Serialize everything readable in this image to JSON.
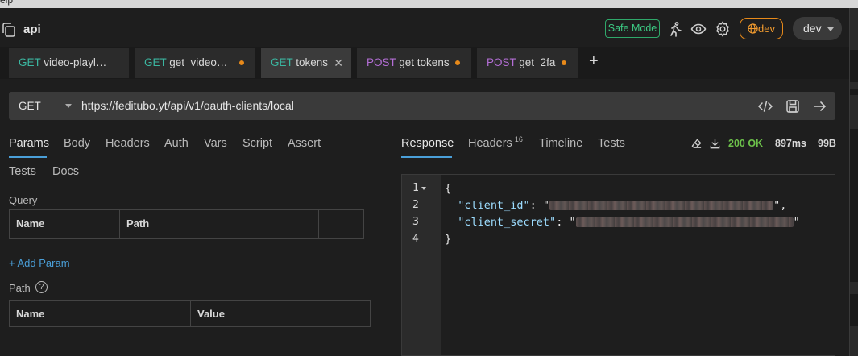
{
  "menubar": {
    "text": "elp"
  },
  "header": {
    "title": "api",
    "safe_mode": "Safe Mode",
    "env_badge": "dev",
    "env_select": "dev",
    "icons": [
      "collection-icon",
      "runner-icon",
      "eye-icon",
      "gear-icon",
      "globe-icon"
    ]
  },
  "tabs": [
    {
      "method": "GET",
      "name": "video-playl…",
      "unsaved": false
    },
    {
      "method": "GET",
      "name": "get_video…",
      "unsaved": true
    },
    {
      "method": "GET",
      "name": "tokens",
      "active": true,
      "closable": true
    },
    {
      "method": "POST",
      "name": "get tokens",
      "unsaved": true
    },
    {
      "method": "POST",
      "name": "get_2fa",
      "unsaved": true
    }
  ],
  "request": {
    "method": "GET",
    "url": "https://feditubo.yt/api/v1/oauth-clients/local"
  },
  "request_tabs": [
    "Params",
    "Body",
    "Headers",
    "Auth",
    "Vars",
    "Script",
    "Assert",
    "Tests",
    "Docs"
  ],
  "params": {
    "query_label": "Query",
    "query_columns": [
      "Name",
      "Path"
    ],
    "add_param": "+ Add Param",
    "path_label": "Path",
    "help": "?",
    "path_columns": [
      "Name",
      "Value"
    ]
  },
  "response": {
    "tabs": [
      "Response",
      "Headers",
      "Timeline",
      "Tests"
    ],
    "headers_count": "16",
    "status": "200 OK",
    "time": "897ms",
    "size": "99B",
    "line_numbers": [
      "1",
      "2",
      "3",
      "4"
    ],
    "open_brace": "{",
    "key1": "\"client_id\"",
    "key2": "\"client_secret\"",
    "close_brace": "}"
  },
  "colors": {
    "accent": "#4a9fd8",
    "get": "#3bb6a0",
    "post": "#b46ed6",
    "ok": "#6cc04a",
    "env": "#f39c2f",
    "safe": "#3cc983"
  }
}
